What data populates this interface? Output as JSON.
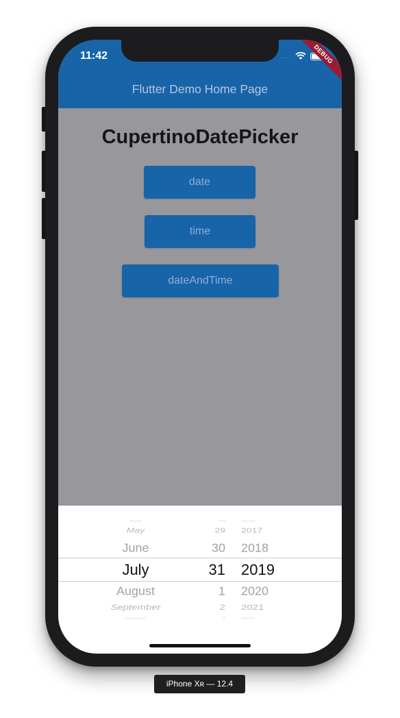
{
  "status_bar": {
    "time": "11:42",
    "signal": "....",
    "wifi_icon": "wifi-icon",
    "battery_icon": "battery-icon"
  },
  "app_bar": {
    "title": "Flutter Demo Home Page",
    "color": "#1864a9",
    "debug_banner": "DEBUG"
  },
  "page": {
    "heading": "CupertinoDatePicker"
  },
  "buttons": {
    "date": "date",
    "time": "time",
    "date_and_time": "dateAndTime"
  },
  "picker": {
    "months": [
      "April",
      "May",
      "June",
      "July",
      "August",
      "September",
      "October"
    ],
    "days": [
      "28",
      "29",
      "30",
      "31",
      "1",
      "2",
      "3"
    ],
    "years": [
      "2016",
      "2017",
      "2018",
      "2019",
      "2020",
      "2021",
      "2022"
    ],
    "selected": {
      "month": "July",
      "day": "31",
      "year": "2019"
    }
  },
  "device": {
    "label": "iPhone Xʀ — 12.4"
  }
}
